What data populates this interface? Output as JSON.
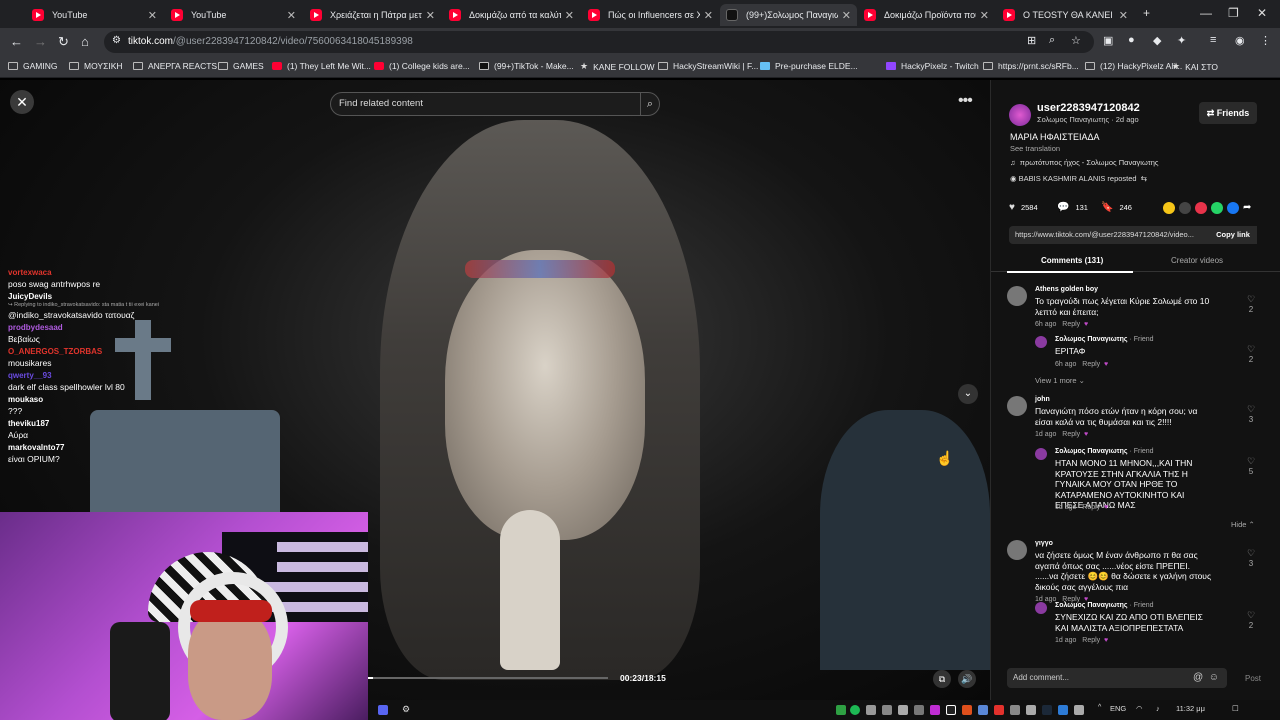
{
  "browser": {
    "tabs": [
      {
        "label": "YouTube",
        "icon": "youtube-icon",
        "active": false
      },
      {
        "label": "YouTube",
        "icon": "youtube-icon",
        "active": false
      },
      {
        "label": "Χρειάζεται η Πάτρα μετρ",
        "icon": "youtube-icon",
        "active": false
      },
      {
        "label": "Δοκιμάζω από τα καλύτε",
        "icon": "youtube-icon",
        "active": false
      },
      {
        "label": "Πώς οι Influencers σε ΧΕΡ",
        "icon": "youtube-icon",
        "active": false
      },
      {
        "label": "(99+)Σολωμος Παναγιωτ",
        "icon": "tiktok-icon",
        "active": true
      },
      {
        "label": "Δοκιμάζω Προϊόντα που",
        "icon": "youtube-icon",
        "active": false
      },
      {
        "label": "Ο TEOSTY ΘΑ ΚΑΝΕΙ IRL",
        "icon": "youtube-icon",
        "active": false
      }
    ],
    "new_tab": "+",
    "url_host": "tiktok.com",
    "url_path": "/@user2283947120842/video/7560063418045189398",
    "bookmarks": [
      {
        "label": "GAMING",
        "icon": "folder"
      },
      {
        "label": "ΜΟΥΣΙΚΗ",
        "icon": "folder"
      },
      {
        "label": "ΑΝΕΡΓΑ REACTS",
        "icon": "folder"
      },
      {
        "label": "GAMES",
        "icon": "folder"
      },
      {
        "label": "(1) They Left Me Wit...",
        "icon": "youtube"
      },
      {
        "label": "(1) College kids are...",
        "icon": "youtube"
      },
      {
        "label": "(99+)TikTok - Make...",
        "icon": "tiktok"
      },
      {
        "label": "ΚΑΝΕ FOLLOW",
        "icon": "star"
      },
      {
        "label": "HackyStreamWiki | F...",
        "icon": "page"
      },
      {
        "label": "Pre-purchase ELDE...",
        "icon": "steam"
      },
      {
        "label": "HackyPixelz - Twitch",
        "icon": "twitch"
      },
      {
        "label": "https://prnt.sc/sRFb...",
        "icon": "page"
      },
      {
        "label": "(12) HackyPixelz Ali...",
        "icon": "page"
      },
      {
        "label": "ΚΑΙ ΣΤΟ",
        "icon": "star"
      }
    ]
  },
  "video": {
    "search_placeholder": "Find related content",
    "time": "00:23/18:15",
    "progress": 0.021
  },
  "chat": [
    {
      "user": "vortexwaca",
      "color": "#e0342c",
      "text": "poso swag antrhwpos re",
      "reply": ""
    },
    {
      "user": "JuicyDevils",
      "color": "#ffffff",
      "text": "@indiko_stravokatsavido τατουαζ",
      "reply": "↪ Replying to indiko_stravokatsavido: sta matia t tii exei kanei"
    },
    {
      "user": "prodbydesaad",
      "color": "#b05be0",
      "text": "Βεβαίως",
      "reply": ""
    },
    {
      "user": "O_ANERGOS_TZORBAS",
      "color": "#e0342c",
      "text": "mousikares",
      "reply": ""
    },
    {
      "user": "qwerty__93",
      "color": "#6a4be0",
      "text": "dark elf class spellhowler lvl 80",
      "reply": ""
    },
    {
      "user": "moukaso",
      "color": "#ffffff",
      "text": "???",
      "reply": ""
    },
    {
      "user": "theviku187",
      "color": "#ffffff",
      "text": "Αύρα",
      "reply": ""
    },
    {
      "user": "markovalnto77",
      "color": "#ffffff",
      "text": "είναι OPIUM?",
      "reply": ""
    }
  ],
  "panel": {
    "username": "user2283947120842",
    "subline": "Σολωμος Παναγιωτης · 2d ago",
    "friends_label": "Friends",
    "description": "ΜΑΡΙΑ ΗΦΑΙΣΤΕΙΑΔΑ",
    "see_translation": "See translation",
    "music": "πρωτότυπος ήχος - Σολωμος Παναγιωτης",
    "repost": "BABIS KASHMIR ALANIS reposted",
    "likes": "2584",
    "comments_count": "131",
    "saves": "246",
    "link": "https://www.tiktok.com/@user2283947120842/video...",
    "copy_link": "Copy link",
    "tab_comments": "Comments (131)",
    "tab_creator": "Creator videos",
    "add_comment": "Add comment...",
    "post": "Post",
    "comments": [
      {
        "name": "Athens golden boy",
        "friend": "",
        "text": "Το τραγούδι πως λέγεται Κύριε Σολωμέ στο 10 λεπτό και έπειτα;",
        "meta": "6h ago",
        "reply": "Reply",
        "likes": "2"
      },
      {
        "name": "Σολωμος Παναγιωτης",
        "friend": " · Friend",
        "text": "ΕΡΙΤΑΦ",
        "meta": "6h ago",
        "reply": "Reply",
        "likes": "2"
      },
      {
        "name": "john",
        "friend": "",
        "text": "Παναγιώτη πόσο ετών ήταν η κόρη σου; να είσαι καλά να τις θυμάσαι και τις 2!!!!",
        "meta": "1d ago",
        "reply": "Reply",
        "likes": "3"
      },
      {
        "name": "Σολωμος Παναγιωτης",
        "friend": " · Friend",
        "text": "ΗΤΑΝ ΜΟΝΟ 11 ΜΗΝΟΝ,,,ΚΑΙ ΤΗΝ ΚΡΑΤΟΥΣΕ ΣΤΗΝ ΑΓΚΑΛΙΑ ΤΗΣ Η ΓΥΝΑΙΚΑ ΜΟΥ ΟΤΑΝ ΗΡΘΕ ΤΟ ΚΑΤΑΡΑΜΕΝΟ ΑΥΤΟΚΙΝΗΤΟ ΚΑΙ ΕΠΕΣΕ ΑΠΑΝΩ ΜΑΣ",
        "meta": "1d ago",
        "reply": "Reply",
        "likes": "5"
      },
      {
        "name": "γιγγο",
        "friend": "",
        "text": "να ζήσετε όμως Μ έναν άνθρωπο π θα σας αγαπά όπως σας ......νέος είστε ΠΡΕΠΕΙ. ......να ζήσετε 😊😊 θα δώσετε κ γαλήνη στους δικούς σας αγγέλους πια",
        "meta": "1d ago",
        "reply": "Reply",
        "likes": "3"
      },
      {
        "name": "Σολωμος Παναγιωτης",
        "friend": " · Friend",
        "text": "ΣΥΝΕΧΙΖΩ ΚΑΙ ΖΩ ΑΠΟ ΟΤΙ ΒΛΕΠΕΙΣ ΚΑΙ ΜΑΛΙΣΤΑ ΑΞΙΟΠΡΕΠΕΣΤΑΤΑ",
        "meta": "1d ago",
        "reply": "Reply",
        "likes": "2"
      }
    ],
    "view_more": "View 1 more",
    "hide": "Hide"
  },
  "taskbar": {
    "lang": "ENG",
    "clock": "11:32 μμ"
  }
}
